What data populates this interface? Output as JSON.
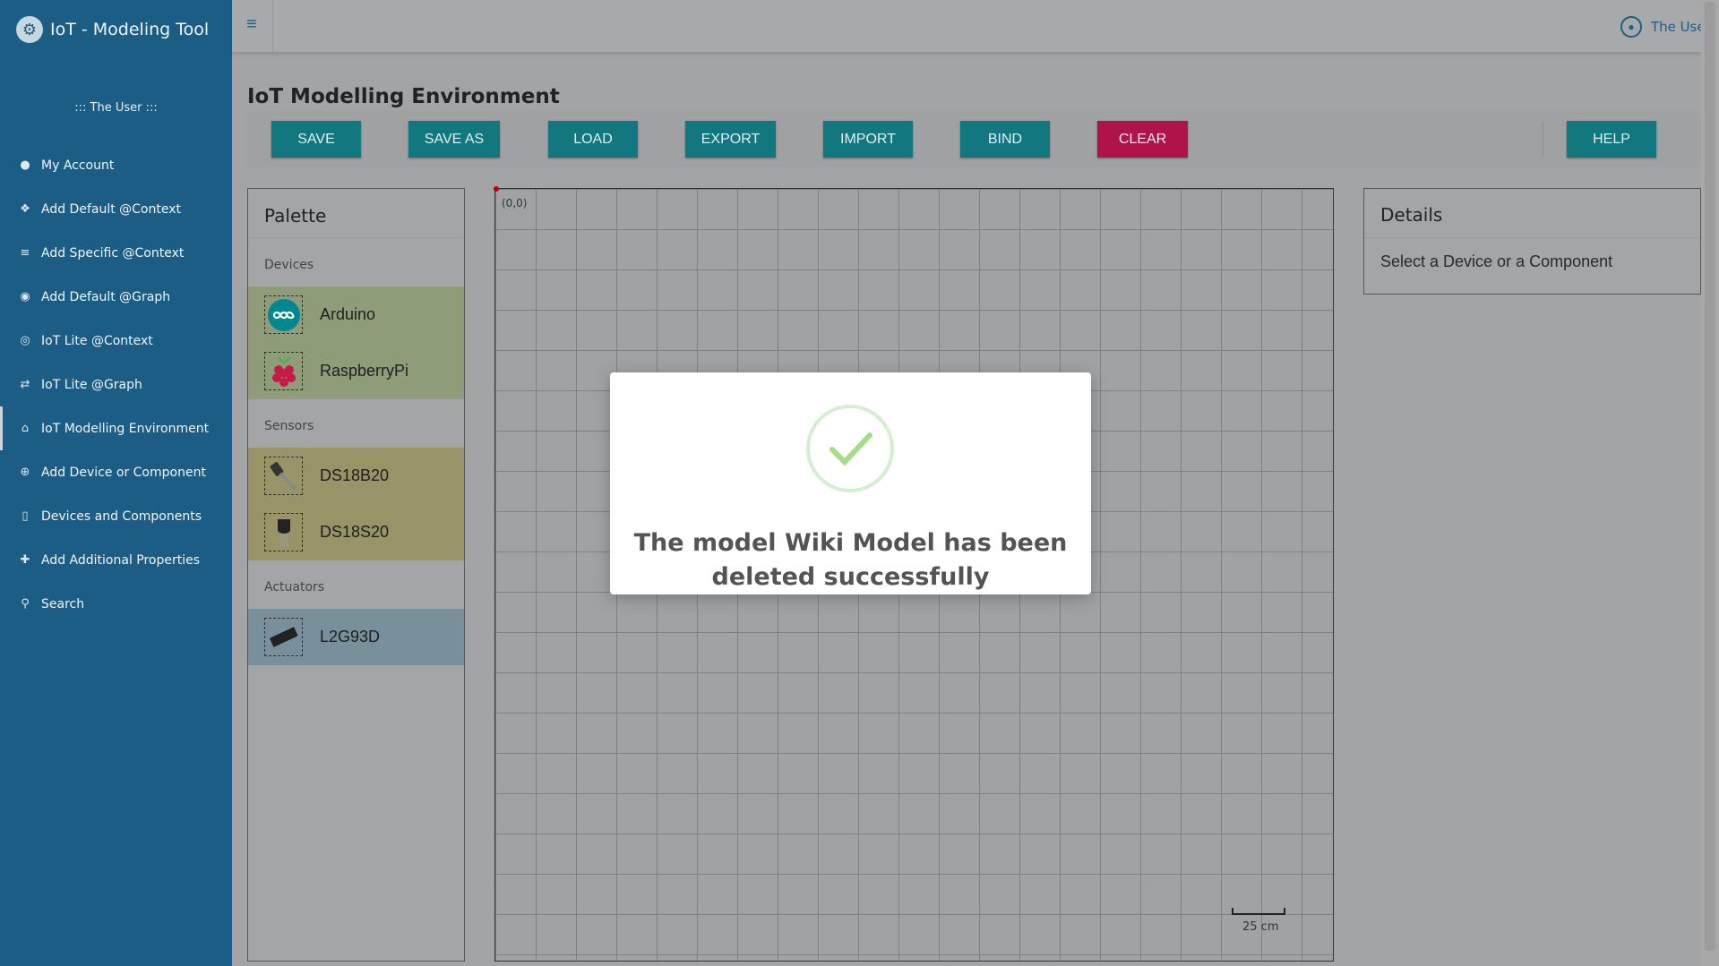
{
  "brand": {
    "title": "IoT - Modeling Tool"
  },
  "sidebar": {
    "user_caption": "::: The User :::",
    "items": [
      {
        "label": "My Account",
        "icon": "user-icon"
      },
      {
        "label": "Add Default @Context",
        "icon": "cubes-icon"
      },
      {
        "label": "Add Specific @Context",
        "icon": "database-icon"
      },
      {
        "label": "Add Default @Graph",
        "icon": "compass-icon"
      },
      {
        "label": "IoT Lite @Context",
        "icon": "target-icon"
      },
      {
        "label": "IoT Lite @Graph",
        "icon": "exchange-icon"
      },
      {
        "label": "IoT Modelling Environment",
        "icon": "home-icon"
      },
      {
        "label": "Add Device or Component",
        "icon": "plus-circle-icon"
      },
      {
        "label": "Devices and Components",
        "icon": "square-icon"
      },
      {
        "label": "Add Additional Properties",
        "icon": "puzzle-icon"
      },
      {
        "label": "Search",
        "icon": "search-icon"
      }
    ]
  },
  "topbar": {
    "user_name": "The Use"
  },
  "page": {
    "title": "IoT Modelling Environment"
  },
  "toolbar": {
    "save": "SAVE",
    "save_as": "SAVE AS",
    "load": "LOAD",
    "export": "EXPORT",
    "import": "IMPORT",
    "bind": "BIND",
    "clear": "CLEAR",
    "help": "HELP"
  },
  "palette": {
    "title": "Palette",
    "devices_label": "Devices",
    "devices": [
      "Arduino",
      "RaspberryPi"
    ],
    "sensors_label": "Sensors",
    "sensors": [
      "DS18B20",
      "DS18S20"
    ],
    "actuators_label": "Actuators",
    "actuators": [
      "L2G93D"
    ]
  },
  "canvas": {
    "origin_label": "(0,0)",
    "scale_label": "25 cm"
  },
  "details": {
    "title": "Details",
    "body": "Select a Device or a Component"
  },
  "modal": {
    "message": "The model Wiki Model has been deleted successfully"
  },
  "colors": {
    "sidebar": "#1c5d86",
    "button": "#12777f",
    "clear_button": "#b1124b",
    "success": "#a5dc86"
  }
}
